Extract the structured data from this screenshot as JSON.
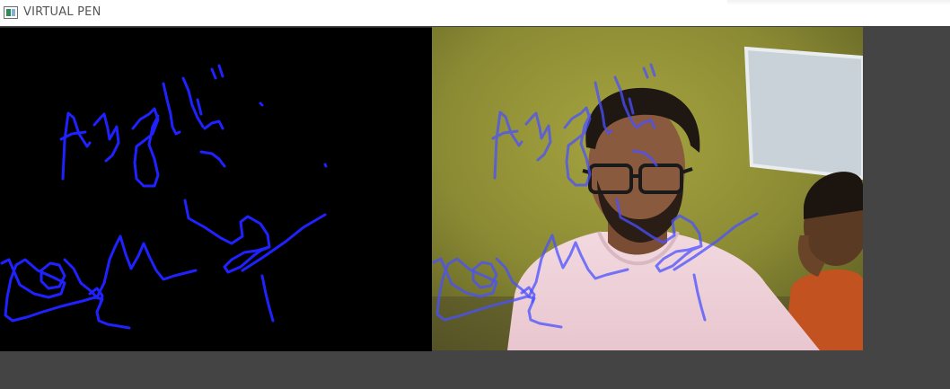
{
  "window": {
    "title": "VIRTUAL PEN",
    "icon": "opencv-window-icon"
  },
  "colors": {
    "ink": "#1f22ff",
    "canvas_background": "#000000",
    "window_background": "#444444",
    "titlebar": "#ffffff"
  },
  "panes": {
    "canvas": "drawing-canvas",
    "webcam": "webcam-feed-with-overlay"
  }
}
